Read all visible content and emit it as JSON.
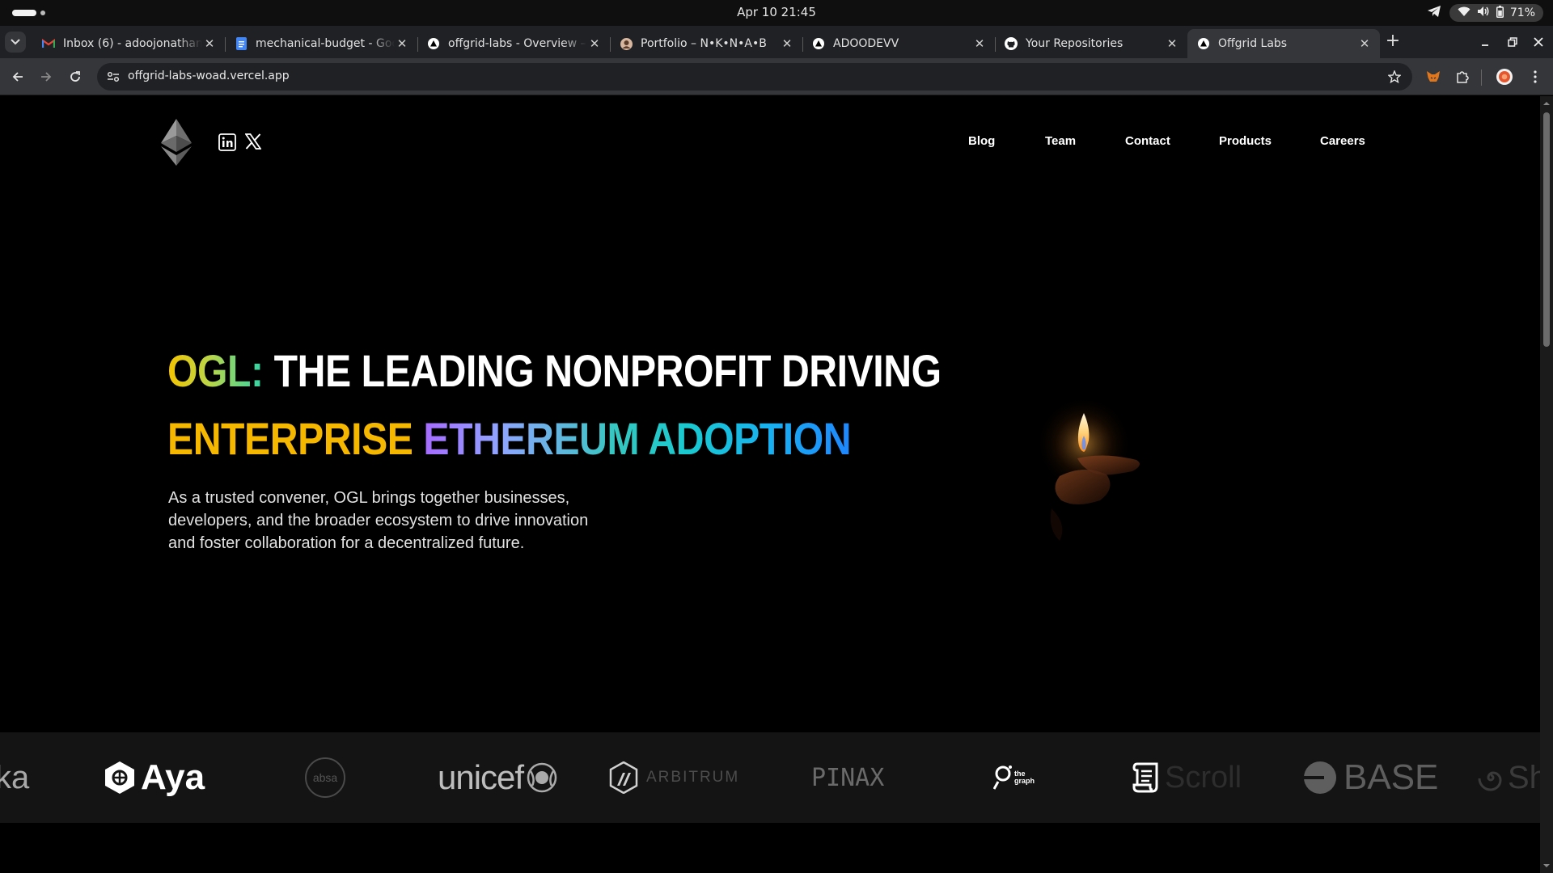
{
  "os": {
    "clock": "Apr 10  21:45",
    "battery": "71%"
  },
  "tabs": [
    {
      "title": "Inbox (6) - adoojonathan",
      "icon": "gmail-icon",
      "active": false
    },
    {
      "title": "mechanical-budget - Goo",
      "icon": "google-docs-icon",
      "active": false
    },
    {
      "title": "offgrid-labs - Overview –",
      "icon": "vercel-icon",
      "active": false
    },
    {
      "title": "Portfolio – N•K•N•A•B",
      "icon": "avatar-icon",
      "active": false
    },
    {
      "title": "ADOODEVV",
      "icon": "vercel-icon",
      "active": false
    },
    {
      "title": "Your Repositories",
      "icon": "github-icon",
      "active": false
    },
    {
      "title": "Offgrid Labs",
      "icon": "vercel-icon",
      "active": true
    }
  ],
  "address_bar": {
    "url": "offgrid-labs-woad.vercel.app"
  },
  "site": {
    "nav": [
      "Blog",
      "Team",
      "Contact",
      "Products",
      "Careers"
    ],
    "hero": {
      "line1_prefix": "OGL:",
      "line1_rest": "THE LEADING NONPROFIT DRIVING",
      "line2_a": "ENTERPRISE",
      "line2_b": "ETHEREUM ADOPTION",
      "description": "As a trusted convener, OGL brings together businesses, developers, and the broader ecosystem to drive innovation and foster collaboration for a decentralized future."
    },
    "partners": {
      "partial_left": "ka",
      "aya": "Aya",
      "absa": "absa",
      "unicef": "unicef",
      "arbitrum": "ARBITRUM",
      "pinax": "PINAX",
      "the_graph_line1": "the",
      "the_graph_line2": "graph",
      "scroll": "Scroll",
      "base": "BASE",
      "partial_right": "Sh"
    }
  },
  "colors": {
    "gradient_yellow": "#f5b700",
    "gradient_teal": "#2fd3a8",
    "gradient_blue": "#1e86ff",
    "gradient_purple": "#a66bff"
  }
}
